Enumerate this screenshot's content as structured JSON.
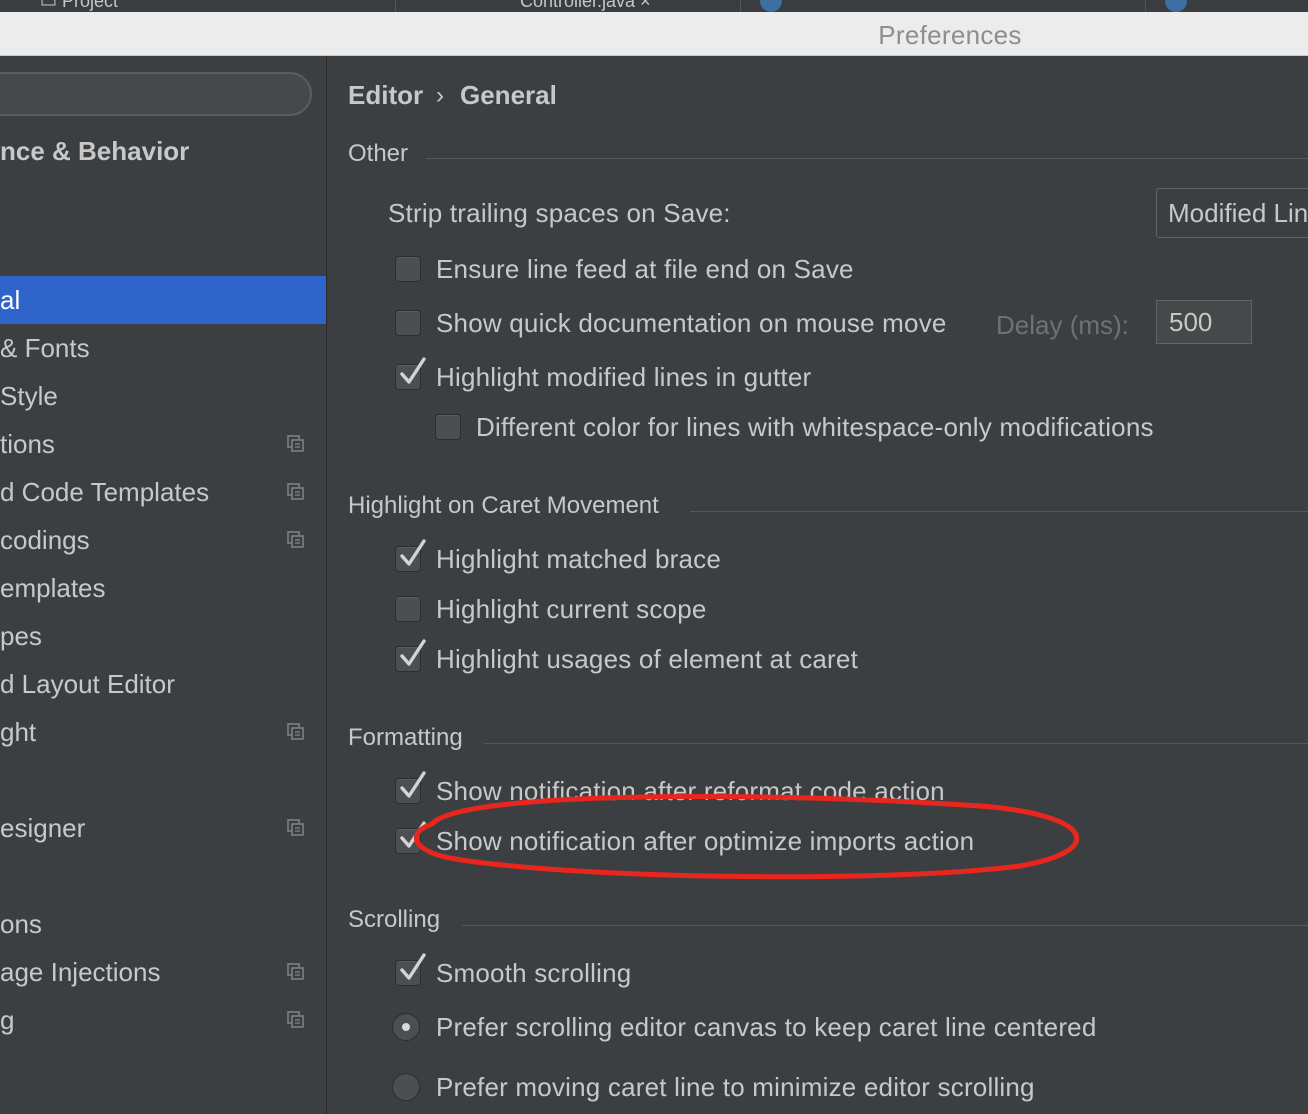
{
  "window": {
    "title": "Preferences"
  },
  "sidebar": {
    "section_title": "nce & Behavior",
    "items": [
      {
        "label": "al",
        "selected": true,
        "copy_icon": false
      },
      {
        "label": "& Fonts",
        "selected": false,
        "copy_icon": false
      },
      {
        "label": "Style",
        "selected": false,
        "copy_icon": false
      },
      {
        "label": "tions",
        "selected": false,
        "copy_icon": true
      },
      {
        "label": "d Code Templates",
        "selected": false,
        "copy_icon": true
      },
      {
        "label": "codings",
        "selected": false,
        "copy_icon": true
      },
      {
        "label": "emplates",
        "selected": false,
        "copy_icon": false
      },
      {
        "label": "pes",
        "selected": false,
        "copy_icon": false
      },
      {
        "label": "d Layout Editor",
        "selected": false,
        "copy_icon": false
      },
      {
        "label": "ght",
        "selected": false,
        "copy_icon": true
      },
      {
        "label": "",
        "selected": false,
        "copy_icon": false
      },
      {
        "label": "esigner",
        "selected": false,
        "copy_icon": true
      },
      {
        "label": "",
        "selected": false,
        "copy_icon": false
      },
      {
        "label": "ons",
        "selected": false,
        "copy_icon": false
      },
      {
        "label": "age Injections",
        "selected": false,
        "copy_icon": true
      },
      {
        "label": "g",
        "selected": false,
        "copy_icon": true
      }
    ]
  },
  "breadcrumb": {
    "part1": "Editor",
    "separator": "›",
    "part2": "General"
  },
  "sections": {
    "other": "Other",
    "caret": "Highlight on Caret Movement",
    "formatting": "Formatting",
    "scrolling": "Scrolling"
  },
  "other": {
    "strip_label": "Strip trailing spaces on Save:",
    "strip_value": "Modified Lin",
    "delay_label": "Delay (ms):",
    "delay_value": "500",
    "options": [
      {
        "label": "Ensure line feed at file end on Save",
        "checked": false
      },
      {
        "label": "Show quick documentation on mouse move",
        "checked": false
      },
      {
        "label": "Highlight modified lines in gutter",
        "checked": true
      },
      {
        "label": "Different color for lines with whitespace-only modifications",
        "checked": false
      }
    ]
  },
  "caret": {
    "options": [
      {
        "label": "Highlight matched brace",
        "checked": true
      },
      {
        "label": "Highlight current scope",
        "checked": false
      },
      {
        "label": "Highlight usages of element at caret",
        "checked": true
      }
    ]
  },
  "formatting": {
    "options": [
      {
        "label": "Show notification after reformat code action",
        "checked": true
      },
      {
        "label": "Show notification after optimize imports action",
        "checked": true
      }
    ]
  },
  "scrolling": {
    "smooth": {
      "label": "Smooth scrolling",
      "checked": true
    },
    "radios": [
      {
        "label": "Prefer scrolling editor canvas to keep caret line centered",
        "selected": true
      },
      {
        "label": "Prefer moving caret line to minimize editor scrolling",
        "selected": false
      }
    ]
  },
  "colors": {
    "selection": "#2f65ca",
    "annotation": "#e8261d"
  }
}
